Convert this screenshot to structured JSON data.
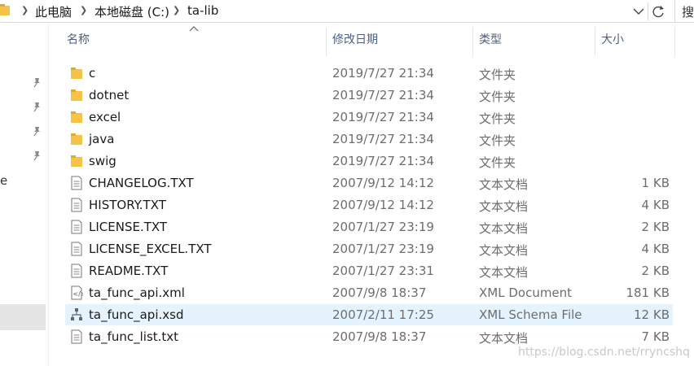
{
  "address_bar": {
    "breadcrumbs": [
      "此电脑",
      "本地磁盘 (C:)",
      "ta-lib"
    ],
    "search_text": "搜"
  },
  "nav": {
    "partial_label": "e"
  },
  "columns": {
    "name": "名称",
    "date": "修改日期",
    "type": "类型",
    "size": "大小"
  },
  "files": [
    {
      "name": "c",
      "date": "2019/7/27 21:34",
      "type": "文件夹",
      "size": "",
      "icon": "folder-icon"
    },
    {
      "name": "dotnet",
      "date": "2019/7/27 21:34",
      "type": "文件夹",
      "size": "",
      "icon": "folder-icon"
    },
    {
      "name": "excel",
      "date": "2019/7/27 21:34",
      "type": "文件夹",
      "size": "",
      "icon": "folder-icon"
    },
    {
      "name": "java",
      "date": "2019/7/27 21:34",
      "type": "文件夹",
      "size": "",
      "icon": "folder-icon"
    },
    {
      "name": "swig",
      "date": "2019/7/27 21:34",
      "type": "文件夹",
      "size": "",
      "icon": "folder-icon"
    },
    {
      "name": "CHANGELOG.TXT",
      "date": "2007/9/12 14:12",
      "type": "文本文档",
      "size": "1 KB",
      "icon": "text-file-icon"
    },
    {
      "name": "HISTORY.TXT",
      "date": "2007/9/12 14:12",
      "type": "文本文档",
      "size": "4 KB",
      "icon": "text-file-icon"
    },
    {
      "name": "LICENSE.TXT",
      "date": "2007/1/27 23:19",
      "type": "文本文档",
      "size": "2 KB",
      "icon": "text-file-icon"
    },
    {
      "name": "LICENSE_EXCEL.TXT",
      "date": "2007/1/27 23:19",
      "type": "文本文档",
      "size": "4 KB",
      "icon": "text-file-icon"
    },
    {
      "name": "README.TXT",
      "date": "2007/1/27 23:31",
      "type": "文本文档",
      "size": "2 KB",
      "icon": "text-file-icon"
    },
    {
      "name": "ta_func_api.xml",
      "date": "2007/9/8 18:37",
      "type": "XML Document",
      "size": "181 KB",
      "icon": "xml-file-icon"
    },
    {
      "name": "ta_func_api.xsd",
      "date": "2007/2/11 17:25",
      "type": "XML Schema File",
      "size": "12 KB",
      "icon": "xsd-file-icon",
      "selected": true
    },
    {
      "name": "ta_func_list.txt",
      "date": "2007/9/8 18:37",
      "type": "文本文档",
      "size": "7 KB",
      "icon": "text-file-icon"
    }
  ],
  "watermark": "https://blog.csdn.net/rryncshq",
  "colors": {
    "folder": "#f5c446",
    "selected_row": "#e5f3ff",
    "header_text": "#4d6082",
    "detail_text": "#6d6d6d"
  }
}
